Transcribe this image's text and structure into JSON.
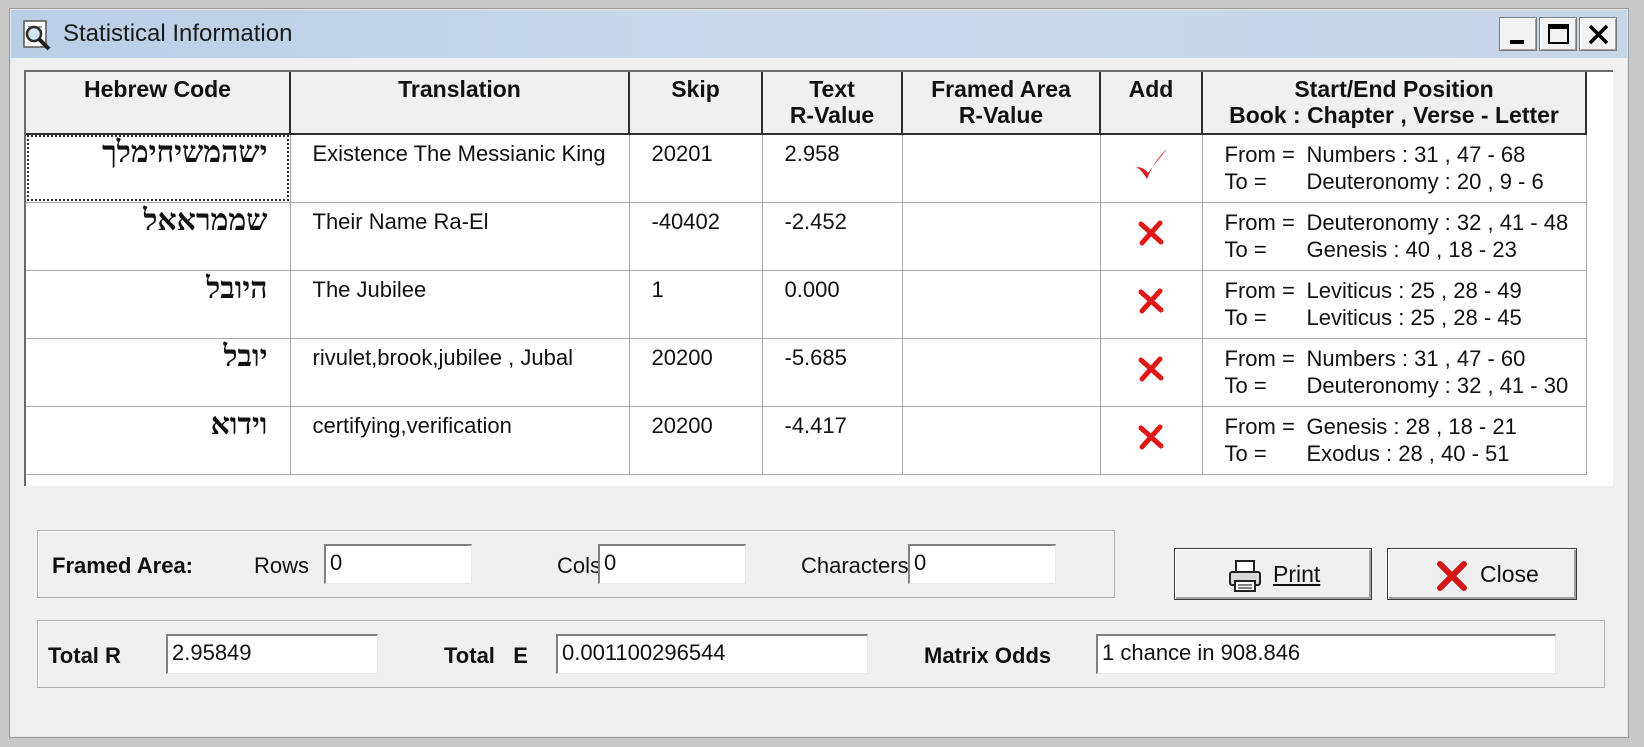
{
  "window": {
    "title": "Statistical Information",
    "icon": "magnifier-app-icon",
    "controls": [
      "minimize-icon",
      "maximize-icon",
      "close-icon"
    ]
  },
  "grid": {
    "headers": [
      {
        "line1": "Hebrew Code",
        "line2": ""
      },
      {
        "line1": "Translation",
        "line2": ""
      },
      {
        "line1": "Skip",
        "line2": ""
      },
      {
        "line1": "Text",
        "line2": "R-Value"
      },
      {
        "line1": "Framed Area",
        "line2": "R-Value"
      },
      {
        "line1": "Add",
        "line2": ""
      },
      {
        "line1": "Start/End Position",
        "line2": "Book : Chapter , Verse - Letter"
      }
    ],
    "rows": [
      {
        "hebrew": "ישהמשיחימלך",
        "translation": "Existence The Messianic King",
        "skip": "20201",
        "text_r": "2.958",
        "framed_r": "",
        "add": "check",
        "from_label": "From =",
        "from": "Numbers : 31 , 47 - 68",
        "to_label": "To =",
        "to": "Deuteronomy : 20 , 9 - 6"
      },
      {
        "hebrew": "שממראאל",
        "translation": "Their Name Ra-El",
        "skip": "-40402",
        "text_r": "-2.452",
        "framed_r": "",
        "add": "cross",
        "from_label": "From =",
        "from": "Deuteronomy : 32 , 41 - 48",
        "to_label": "To =",
        "to": "Genesis : 40 , 18 - 23"
      },
      {
        "hebrew": "היובל",
        "translation": "The Jubilee",
        "skip": "1",
        "text_r": "0.000",
        "framed_r": "",
        "add": "cross",
        "from_label": "From =",
        "from": "Leviticus : 25 , 28 - 49",
        "to_label": "To =",
        "to": "Leviticus : 25 , 28 - 45"
      },
      {
        "hebrew": "יובל",
        "translation": "rivulet,brook,jubilee , Jubal",
        "skip": "20200",
        "text_r": "-5.685",
        "framed_r": "",
        "add": "cross",
        "from_label": "From =",
        "from": "Numbers : 31 , 47 - 60",
        "to_label": "To =",
        "to": "Deuteronomy : 32 , 41 - 30"
      },
      {
        "hebrew": "וידוא",
        "translation": "certifying,verification",
        "skip": "20200",
        "text_r": "-4.417",
        "framed_r": "",
        "add": "cross",
        "from_label": "From =",
        "from": "Genesis : 28 , 18 - 21",
        "to_label": "To =",
        "to": "Exodus : 28 , 40 - 51"
      }
    ]
  },
  "framed_area": {
    "label": "Framed Area:",
    "rows_label": "Rows",
    "rows_value": "0",
    "cols_label": "Cols",
    "cols_value": "0",
    "chars_label": "Characters",
    "chars_value": "0"
  },
  "buttons": {
    "print_label": "Print",
    "print_icon": "printer-icon",
    "close_label": "Close",
    "close_icon": "red-x-icon"
  },
  "totals": {
    "total_r_label": "Total R",
    "total_r_value": "2.95849",
    "total_e_label": "Total   E",
    "total_e_value": "0.001100296544",
    "odds_label": "Matrix Odds",
    "odds_value": "1 chance in 908.846"
  },
  "colors": {
    "check": "#d42020",
    "cross": "#e01818",
    "title_bar": "#c3d5e9"
  }
}
